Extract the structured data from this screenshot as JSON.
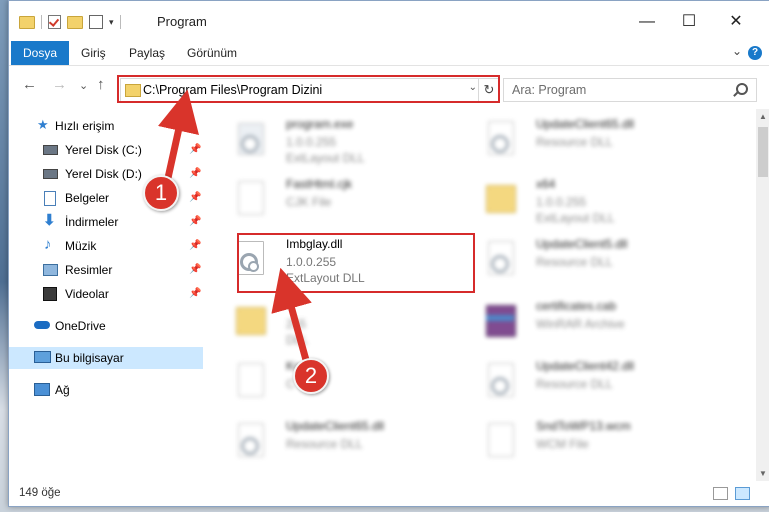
{
  "window": {
    "title": "Program",
    "controls": {
      "minimize": "—",
      "maximize": "☐",
      "close": "✕"
    }
  },
  "ribbon": {
    "tabs": [
      "Dosya",
      "Giriş",
      "Paylaş",
      "Görünüm"
    ],
    "help": "?"
  },
  "nav": {
    "back": "←",
    "forward": "→",
    "dropdown": "⌄",
    "up": "↑"
  },
  "address": {
    "path": "C:\\Program Files\\Program Dizini",
    "refresh": "↻"
  },
  "search": {
    "placeholder": "Ara: Program"
  },
  "sidebar": {
    "items": [
      {
        "label": "Hızlı erişim",
        "icon": "star-icon"
      },
      {
        "label": "Yerel Disk (C:)",
        "icon": "drive-icon"
      },
      {
        "label": "Yerel Disk (D:)",
        "icon": "drive-icon"
      },
      {
        "label": "Belgeler",
        "icon": "documents-icon"
      },
      {
        "label": "İndirmeler",
        "icon": "download-icon"
      },
      {
        "label": "Müzik",
        "icon": "music-icon"
      },
      {
        "label": "Resimler",
        "icon": "pictures-icon"
      },
      {
        "label": "Videolar",
        "icon": "video-icon"
      },
      {
        "label": "OneDrive",
        "icon": "cloud-icon"
      },
      {
        "label": "Bu bilgisayar",
        "icon": "computer-icon"
      },
      {
        "label": "Ağ",
        "icon": "network-icon"
      }
    ]
  },
  "files": [
    {
      "name": "program.exe",
      "line1": "1.0.0.255",
      "line2": "ExtLayout DLL"
    },
    {
      "name": "UpdateClient65.dll",
      "line1": "Resource DLL",
      "line2": ""
    },
    {
      "name": "FastHtml.cjk",
      "line1": "CJK File",
      "line2": ""
    },
    {
      "name": "x64",
      "line1": "1.0.0.255",
      "line2": "ExtLayout DLL"
    },
    {
      "name": "Imbglay.dll",
      "line1": "1.0.0.255",
      "line2": "ExtLayout DLL"
    },
    {
      "name": "UpdateClient5.dll",
      "line1": "Resource DLL",
      "line2": ""
    },
    {
      "name": "",
      "line1": "255",
      "line2": "DLL"
    },
    {
      "name": "certificates.cab",
      "line1": "WinRAR Archive",
      "line2": ""
    },
    {
      "name": "Ko",
      "line1": "C",
      "line2": ""
    },
    {
      "name": "UpdateClient42.dll",
      "line1": "Resource DLL",
      "line2": ""
    },
    {
      "name": "UpdateClient65.dll",
      "line1": "Resource DLL",
      "line2": ""
    },
    {
      "name": "SndToWP13.wcm",
      "line1": "WCM File",
      "line2": ""
    }
  ],
  "status": {
    "count": "149 öğe"
  },
  "markers": {
    "one": "1",
    "two": "2"
  },
  "colors": {
    "accent": "#1979ca",
    "highlight": "#d62b2b",
    "selected": "#cce8ff"
  }
}
